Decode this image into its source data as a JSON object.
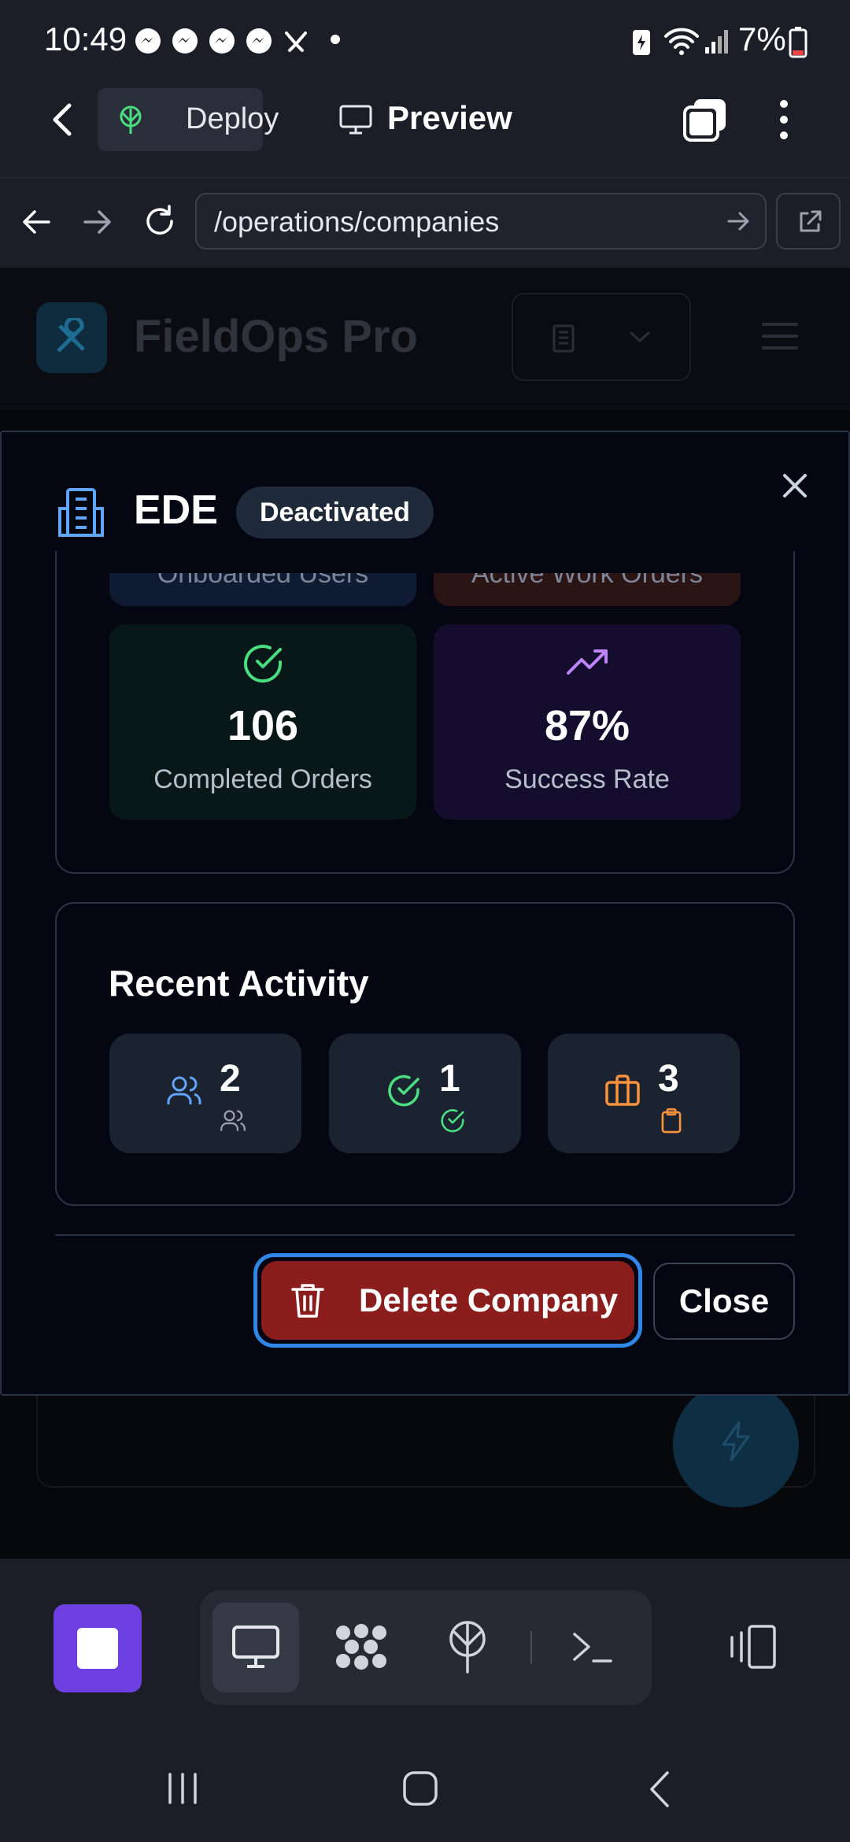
{
  "status_bar": {
    "time": "10:49",
    "battery": "7%"
  },
  "app_header": {
    "deploy_label": "Deploy",
    "preview_label": "Preview"
  },
  "url_bar": {
    "url": "/operations/companies"
  },
  "page": {
    "app_title": "FieldOps Pro"
  },
  "modal": {
    "title": "EDE",
    "status_badge": "Deactivated",
    "stats_partial": [
      {
        "label": "Onboarded Users",
        "color": "#0f1a33"
      },
      {
        "label": "Active Work Orders",
        "color": "#2a1414"
      }
    ],
    "stats": [
      {
        "value": "106",
        "label": "Completed Orders",
        "icon": "check-circle-icon",
        "bg": "#081717",
        "accent": "#4ade80"
      },
      {
        "value": "87%",
        "label": "Success Rate",
        "icon": "trending-up-icon",
        "bg": "#150d2e",
        "accent": "#c084fc"
      }
    ],
    "recent_activity": {
      "title": "Recent Activity",
      "items": [
        {
          "count": "2",
          "icon": "users-icon",
          "accent": "#60a5fa"
        },
        {
          "count": "1",
          "icon": "check-circle-icon",
          "accent": "#4ade80"
        },
        {
          "count": "3",
          "icon": "briefcase-icon",
          "accent": "#fb923c"
        }
      ]
    },
    "delete_button": "Delete Company",
    "close_button": "Close"
  },
  "colors": {
    "danger": "#8c1d1d",
    "focus_ring": "#2f87e8",
    "accent_purple": "#6d3fe0"
  }
}
